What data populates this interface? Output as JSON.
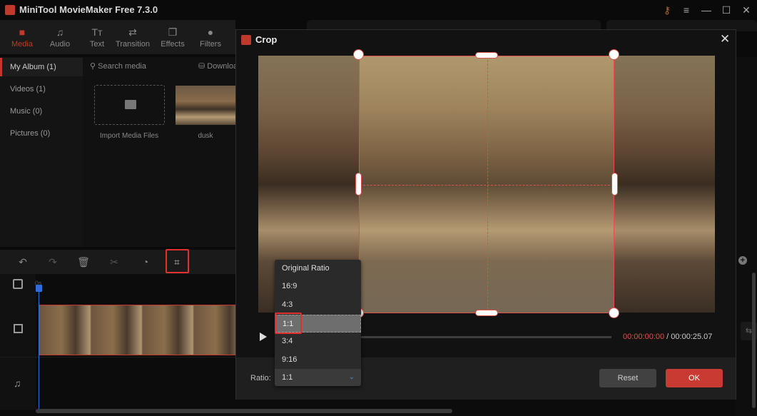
{
  "app": {
    "title": "MiniTool MovieMaker Free 7.3.0"
  },
  "window_controls": [
    "key-icon",
    "menu-icon",
    "minimize-icon",
    "maximize-icon",
    "close-icon"
  ],
  "toolbar": {
    "tabs": [
      {
        "label": "Media",
        "icon": "folder-icon",
        "active": true
      },
      {
        "label": "Audio",
        "icon": "music-note-icon"
      },
      {
        "label": "Text",
        "icon": "text-icon"
      },
      {
        "label": "Transition",
        "icon": "swap-arrows-icon"
      },
      {
        "label": "Effects",
        "icon": "effects-icon"
      },
      {
        "label": "Filters",
        "icon": "filters-icon"
      }
    ]
  },
  "library": {
    "nav": [
      {
        "label": "My Album (1)",
        "active": true
      },
      {
        "label": "Videos (1)"
      },
      {
        "label": "Music (0)"
      },
      {
        "label": "Pictures (0)"
      }
    ],
    "search_placeholder": "Search media",
    "download_label": "Download",
    "import_label": "Import Media Files",
    "media_items": [
      {
        "name": "dusk"
      }
    ]
  },
  "edit_toolbar": [
    "undo-icon",
    "redo-icon",
    "delete-icon",
    "split-icon",
    "speed-icon",
    "crop-icon"
  ],
  "timeline": {
    "ruler_start": "0s"
  },
  "crop_dialog": {
    "title": "Crop",
    "time_current": "00:00:00:00",
    "time_separator": " / ",
    "time_total": "00:00:25.07",
    "ratio_label": "Ratio:",
    "ratio_selected": "1:1",
    "ratio_options": [
      "Original Ratio",
      "16:9",
      "4:3",
      "1:1",
      "3:4",
      "9:16"
    ],
    "reset_label": "Reset",
    "ok_label": "OK",
    "progress": 0,
    "accent": "#c93a32"
  }
}
